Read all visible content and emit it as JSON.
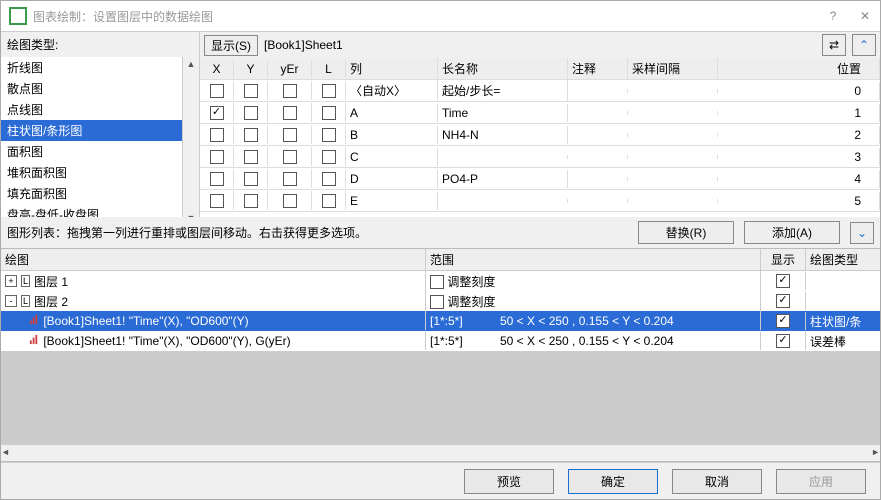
{
  "window": {
    "title": "图表绘制：设置图层中的数据绘图"
  },
  "plot_types": {
    "label": "绘图类型:",
    "items": [
      "折线图",
      "散点图",
      "点线图",
      "柱状图/条形图",
      "面积图",
      "堆积面积图",
      "填充面积图",
      "盘高-盘低-收盘图"
    ],
    "selected_index": 3
  },
  "right": {
    "show_btn": "显示(S)",
    "sheet": "[Book1]Sheet1",
    "columns": {
      "x": "X",
      "y": "Y",
      "yer": "yEr",
      "l": "L",
      "col": "列",
      "longname": "长名称",
      "comment": "注释",
      "sampling": "采样间隔",
      "position": "位置"
    },
    "rows": [
      {
        "x": false,
        "y": false,
        "yer": false,
        "l": false,
        "col": "〈自动X〉",
        "longname": "起始/步长=",
        "comment": "",
        "sampling": "",
        "position": "0"
      },
      {
        "x": true,
        "y": false,
        "yer": false,
        "l": false,
        "col": "A",
        "longname": "Time",
        "comment": "",
        "sampling": "",
        "position": "1"
      },
      {
        "x": false,
        "y": false,
        "yer": false,
        "l": false,
        "col": "B",
        "longname": "NH4-N",
        "comment": "",
        "sampling": "",
        "position": "2"
      },
      {
        "x": false,
        "y": false,
        "yer": false,
        "l": false,
        "col": "C",
        "longname": "",
        "comment": "",
        "sampling": "",
        "position": "3"
      },
      {
        "x": false,
        "y": false,
        "yer": false,
        "l": false,
        "col": "D",
        "longname": "PO4-P",
        "comment": "",
        "sampling": "",
        "position": "4"
      },
      {
        "x": false,
        "y": false,
        "yer": false,
        "l": false,
        "col": "E",
        "longname": "",
        "comment": "",
        "sampling": "",
        "position": "5"
      }
    ]
  },
  "mid": {
    "label": "图形列表：拖拽第一列进行重排或图层间移动。右击获得更多选项。",
    "replace": "替换(R)",
    "add": "添加(A)"
  },
  "plot_list": {
    "headers": {
      "plot": "绘图",
      "range": "范围",
      "show": "显示",
      "type": "绘图类型"
    },
    "layers": [
      {
        "expand": "+",
        "label": "图层 1",
        "adjust_label": "调整刻度",
        "adjust": false,
        "show": true
      },
      {
        "expand": "-",
        "label": "图层 2",
        "adjust_label": "调整刻度",
        "adjust": false,
        "show": true
      }
    ],
    "entries": [
      {
        "sel": true,
        "desc": "[Book1]Sheet1! \"Time\"(X), \"OD600\"(Y)",
        "range1": "[1*:5*]",
        "range2": "50 < X < 250 , 0.155 < Y < 0.204",
        "show": true,
        "type": "柱状图/条"
      },
      {
        "sel": false,
        "desc": "[Book1]Sheet1! \"Time\"(X), \"OD600\"(Y), G(yEr)",
        "range1": "[1*:5*]",
        "range2": "50 < X < 250 , 0.155 < Y < 0.204",
        "show": true,
        "type": "误差棒"
      }
    ]
  },
  "footer": {
    "preview": "预览",
    "ok": "确定",
    "cancel": "取消",
    "apply": "应用"
  }
}
